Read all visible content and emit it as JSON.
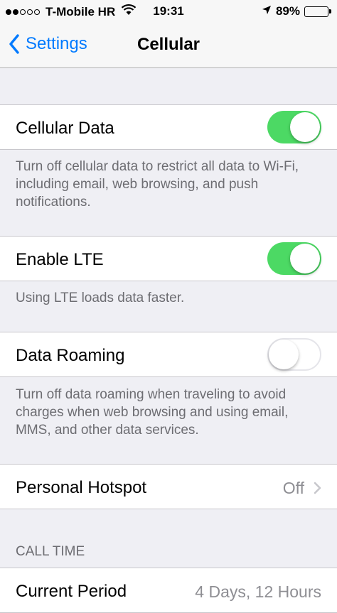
{
  "status_bar": {
    "carrier": "T-Mobile HR",
    "time": "19:31",
    "battery": "89%",
    "battery_level": 0.89
  },
  "nav": {
    "back_label": "Settings",
    "title": "Cellular"
  },
  "cells": {
    "cellular_data": {
      "label": "Cellular Data",
      "toggle": "on"
    },
    "cellular_data_footer": "Turn off cellular data to restrict all data to Wi-Fi, including email, web browsing, and push notifications.",
    "enable_lte": {
      "label": "Enable LTE",
      "toggle": "on"
    },
    "enable_lte_footer": "Using LTE loads data faster.",
    "data_roaming": {
      "label": "Data Roaming",
      "toggle": "off"
    },
    "data_roaming_footer": "Turn off data roaming when traveling to avoid charges when web browsing and using email, MMS, and other data services.",
    "personal_hotspot": {
      "label": "Personal Hotspot",
      "value": "Off"
    },
    "call_time_header": "CALL TIME",
    "current_period": {
      "label": "Current Period",
      "value": "4 Days, 12 Hours"
    }
  },
  "colors": {
    "accent": "#007aff",
    "toggle_on": "#4cd964",
    "footer_text": "#6d6d72",
    "background": "#efeff4"
  },
  "icons": [
    "signal-dots-icon",
    "wifi-icon",
    "location-arrow-icon",
    "battery-icon",
    "chevron-left-icon",
    "chevron-right-icon"
  ]
}
